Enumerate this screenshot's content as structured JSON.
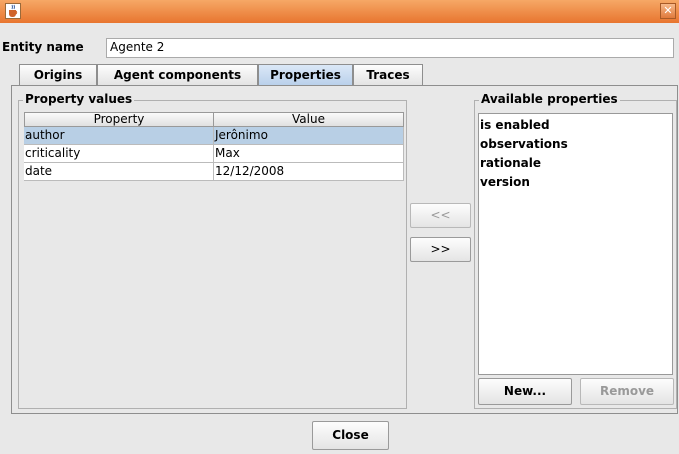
{
  "window": {
    "icon": "java-cup-icon",
    "close_symbol": "✕"
  },
  "entity": {
    "label": "Entity name",
    "value": "Agente 2"
  },
  "tabs": [
    {
      "label": "Origins"
    },
    {
      "label": "Agent components"
    },
    {
      "label": "Properties",
      "active": true
    },
    {
      "label": "Traces"
    }
  ],
  "property_values": {
    "title": "Property values",
    "columns": [
      "Property",
      "Value"
    ],
    "rows": [
      {
        "property": "author",
        "value": "Jerônimo",
        "selected": true
      },
      {
        "property": "criticality",
        "value": "Max"
      },
      {
        "property": "date",
        "value": "12/12/2008"
      }
    ]
  },
  "transfer": {
    "remove_label": "<<",
    "add_label": ">>"
  },
  "available_properties": {
    "title": "Available properties",
    "items": [
      "is enabled",
      "observations",
      "rationale",
      "version"
    ],
    "new_label": "New...",
    "remove_label": "Remove"
  },
  "footer": {
    "close_label": "Close"
  },
  "colors": {
    "titlebar": "#e8752f",
    "selection": "#b8cfe5",
    "active_tab": "#b8cfea"
  }
}
